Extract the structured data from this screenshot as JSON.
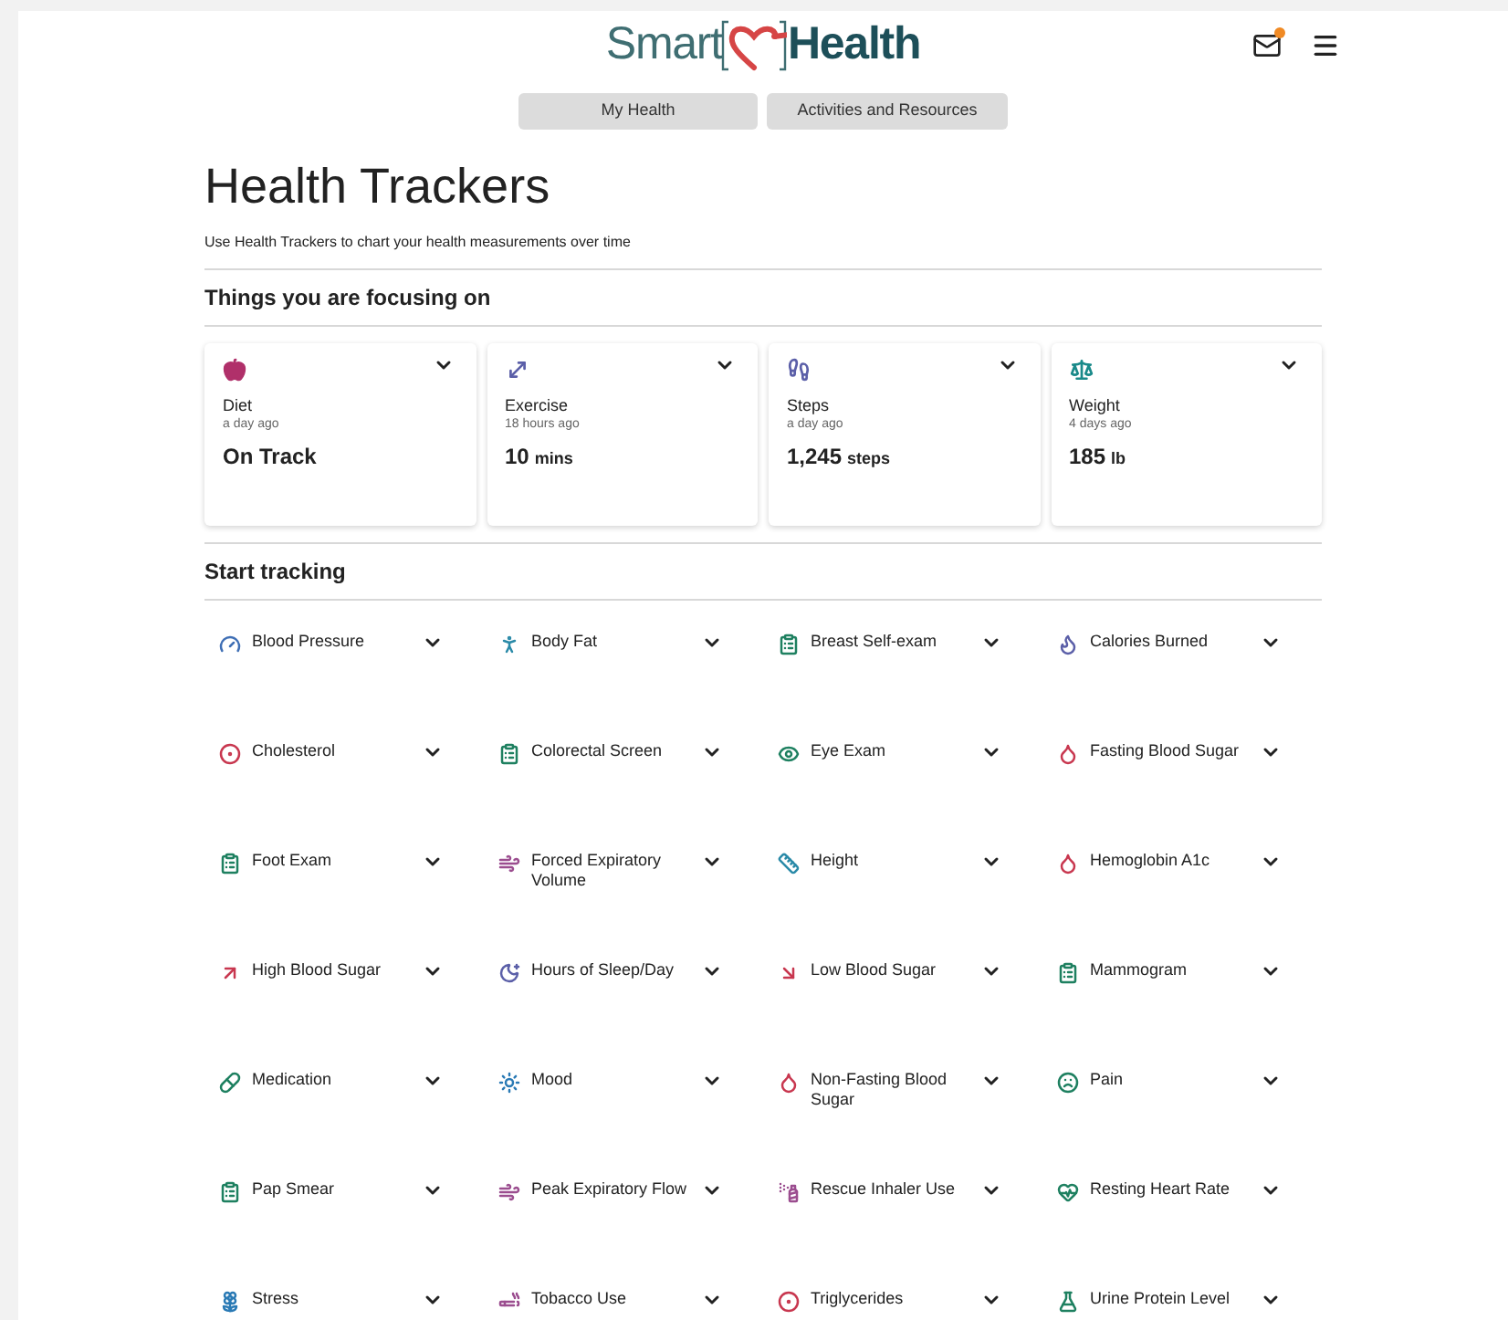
{
  "header": {
    "logo_left": "Smart",
    "logo_right": "Health",
    "mail_unread": true
  },
  "nav": [
    {
      "label": "My Health"
    },
    {
      "label": "Activities and Resources"
    }
  ],
  "page": {
    "title": "Health Trackers",
    "subtitle": "Use Health Trackers to chart your health measurements over time"
  },
  "focus": {
    "heading": "Things you are focusing on",
    "cards": [
      {
        "name": "Diet",
        "time": "a day ago",
        "value": "On Track"
      },
      {
        "name": "Exercise",
        "time": "18 hours ago",
        "value": "10",
        "unit": "mins"
      },
      {
        "name": "Steps",
        "time": "a day ago",
        "value": "1,245",
        "unit": "steps"
      },
      {
        "name": "Weight",
        "time": "4 days ago",
        "value": "185",
        "unit": "lb"
      }
    ]
  },
  "start": {
    "heading": "Start tracking",
    "trackers": [
      {
        "label": "Blood Pressure"
      },
      {
        "label": "Body Fat"
      },
      {
        "label": "Breast Self-exam"
      },
      {
        "label": "Calories Burned"
      },
      {
        "label": "Cholesterol"
      },
      {
        "label": "Colorectal Screen"
      },
      {
        "label": "Eye Exam"
      },
      {
        "label": "Fasting Blood Sugar"
      },
      {
        "label": "Foot Exam"
      },
      {
        "label": "Forced Expiratory Volume"
      },
      {
        "label": "Height"
      },
      {
        "label": "Hemoglobin A1c"
      },
      {
        "label": "High Blood Sugar"
      },
      {
        "label": "Hours of Sleep/Day"
      },
      {
        "label": "Low Blood Sugar"
      },
      {
        "label": "Mammogram"
      },
      {
        "label": "Medication"
      },
      {
        "label": "Mood"
      },
      {
        "label": "Non-Fasting Blood Sugar"
      },
      {
        "label": "Pain"
      },
      {
        "label": "Pap Smear"
      },
      {
        "label": "Peak Expiratory Flow"
      },
      {
        "label": "Rescue Inhaler Use"
      },
      {
        "label": "Resting Heart Rate"
      },
      {
        "label": "Stress"
      },
      {
        "label": "Tobacco Use"
      },
      {
        "label": "Triglycerides"
      },
      {
        "label": "Urine Protein Level"
      }
    ]
  }
}
